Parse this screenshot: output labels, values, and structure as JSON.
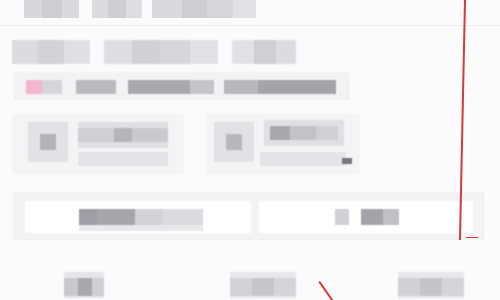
{
  "window": {
    "title": ""
  },
  "tabs": [
    {
      "label": ""
    },
    {
      "label": ""
    },
    {
      "label": ""
    }
  ],
  "header": {
    "title": "",
    "actions": [
      {
        "label": ""
      },
      {
        "label": ""
      }
    ]
  },
  "toolbar": {
    "items": [
      {
        "label": ""
      },
      {
        "label": ""
      },
      {
        "label": ""
      },
      {
        "label": ""
      }
    ]
  },
  "cards": [
    {
      "title": "",
      "subtitle": ""
    },
    {
      "title": "",
      "subtitle": ""
    }
  ],
  "search": {
    "placeholder": ""
  },
  "bottom_nav": [
    {
      "label": ""
    },
    {
      "label": ""
    },
    {
      "label": ""
    }
  ],
  "colors": {
    "accent": "#f2b6cf",
    "annotation": "#d43a3a",
    "blur_light": "#e6e6ea",
    "blur_mid": "#cbcbd1",
    "blur_dark": "#8a8a92"
  }
}
